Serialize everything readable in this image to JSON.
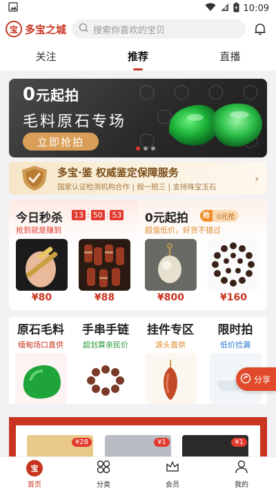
{
  "status_bar": {
    "time": "10:09"
  },
  "header": {
    "logo_mark": "宝",
    "app_name": "多宝之城",
    "search_placeholder": "搜索你喜欢的宝贝"
  },
  "tabs": [
    {
      "label": "关注"
    },
    {
      "label": "推荐"
    },
    {
      "label": "直播"
    }
  ],
  "banner": {
    "title_num": "0",
    "title_text": "元起拍",
    "subtitle": "毛料原石专场",
    "button": "立即抢拍",
    "page_count": 3,
    "active_page": 1
  },
  "certification": {
    "title": "多宝·鉴 权威鉴定保障服务",
    "subtitle": "国家认证检测机构合作 | 假一赔三 | 支持珠宝玉石"
  },
  "flash_sale": {
    "title": "今日秒杀",
    "subtitle": "抢到就是赚到",
    "countdown": {
      "h": "13",
      "m": "50",
      "s": "53"
    },
    "items": [
      {
        "price": "¥80"
      },
      {
        "price": "¥88"
      }
    ]
  },
  "zero_auction": {
    "title": "0元起拍",
    "tag_key": "抢",
    "tag_value": "0元抢",
    "subtitle": "超值低价，好货不错过",
    "items": [
      {
        "price": "¥800"
      },
      {
        "price": "¥160"
      }
    ]
  },
  "categories": [
    {
      "title": "原石毛料",
      "subtitle": "缅甸场口直供"
    },
    {
      "title": "手串手链",
      "subtitle": "超划算亲民价"
    },
    {
      "title": "挂件专区",
      "subtitle": "源头直供"
    },
    {
      "title": "限时拍",
      "subtitle": "低价捡漏"
    }
  ],
  "share_button": {
    "label": "分享"
  },
  "featured": {
    "badges": [
      "¥28",
      "¥1",
      "¥1"
    ]
  },
  "bottom_nav": [
    {
      "label": "首页",
      "icon": "home-icon"
    },
    {
      "label": "分类",
      "icon": "category-icon"
    },
    {
      "label": "会员",
      "icon": "crown-icon"
    },
    {
      "label": "我的",
      "icon": "profile-icon"
    }
  ],
  "colors": {
    "brand": "#c8341f",
    "accent_gold": "#d99f58",
    "price": "#c8341f"
  }
}
